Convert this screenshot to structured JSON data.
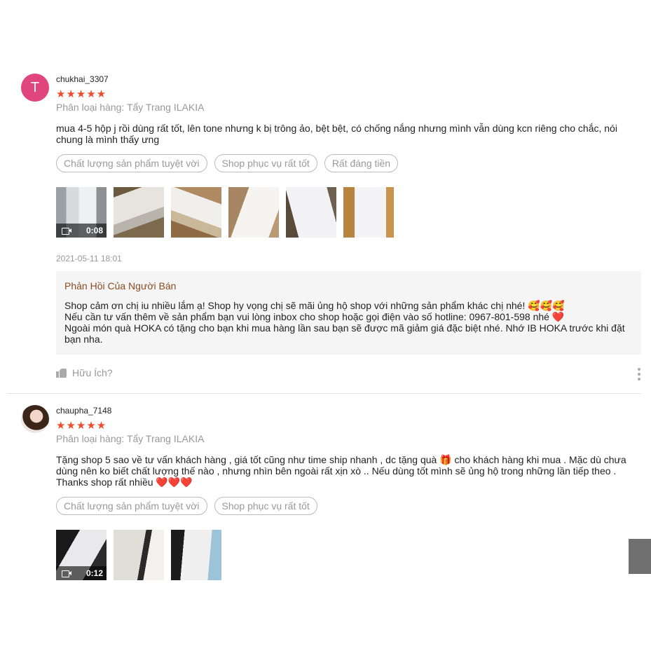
{
  "reviews": [
    {
      "avatar_letter": "T",
      "username": "chukhai_3307",
      "stars": "★★★★★",
      "variation": "Phân loại hàng: Tẩy Trang ILAKIA",
      "content": "mua 4-5 hộp j rồi dùng rất tốt, lên tone nhưng k bị trông ảo, bệt bệt, có chống nắng nhưng mình vẫn dùng kcn riêng cho chắc, nói chung là mình thấy ưng",
      "tags": [
        "Chất lượng sản phẩm tuyệt vời",
        "Shop phục vụ rất tốt",
        "Rất đáng tiền"
      ],
      "video_duration": "0:08",
      "date": "2021-05-11 18:01",
      "seller_reply": {
        "title": "Phản Hồi Của Người Bán",
        "line1": "Shop cảm ơn chị iu nhiều lắm ạ! Shop hy vọng chị sẽ mãi ủng hộ shop với những sản phẩm khác chị nhé! 🥰🥰🥰",
        "line2": "Nếu cần tư vấn thêm về sản phẩm bạn vui lòng inbox cho shop hoặc gọi điện vào số hotline: 0967-801-598 nhé ❤️",
        "line3": "Ngoài món quà HOKA có tặng cho bạn khi mua hàng lần sau bạn sẽ được mã giảm giá đặc biệt nhé. Nhớ IB HOKA trước khi đặt bạn nha."
      },
      "helpful_label": "Hữu Ích?"
    },
    {
      "username": "chaupha_7148",
      "stars": "★★★★★",
      "variation": "Phân loại hàng: Tẩy Trang ILAKIA",
      "content_line1": "Tặng shop 5 sao về tư vấn khách hàng , giá tốt cũng như time ship nhanh , dc tặng quà 🎁 cho khách hàng khi mua . Mặc dù chưa dùng nên ko biết chất lượng thế nào , nhưng nhìn bên ngoài rất xịn xò .. Nếu dùng tốt mình sẽ ủng hộ trong những lần tiếp theo .",
      "content_line2": "Thanks shop rất nhiều ❤️❤️❤️",
      "tags": [
        "Chất lượng sản phẩm tuyệt vời",
        "Shop phục vụ rất tốt"
      ],
      "video_duration": "0:12"
    }
  ],
  "colors": {
    "star": "#ee4d2d",
    "seller_title": "#8a4c21",
    "avatar_bg": "#e0457b"
  },
  "icons": [
    "video-camera-icon",
    "thumbs-up-icon",
    "more-vertical-icon"
  ]
}
